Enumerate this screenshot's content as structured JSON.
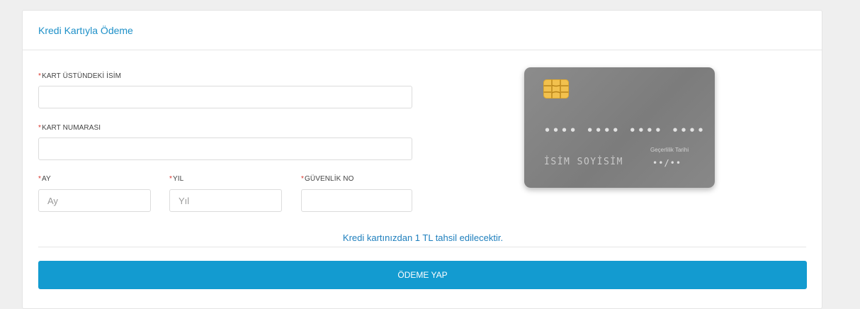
{
  "header": {
    "title": "Kredi Kartıyla Ödeme"
  },
  "form": {
    "required_mark": "*",
    "card_name": {
      "label": "KART ÜSTÜNDEKİ İSİM",
      "value": "",
      "placeholder": ""
    },
    "card_number": {
      "label": "KART NUMARASI",
      "value": "",
      "placeholder": ""
    },
    "month": {
      "label": "AY",
      "value": "",
      "placeholder": "Ay"
    },
    "year": {
      "label": "YIL",
      "value": "",
      "placeholder": "Yıl"
    },
    "cvv": {
      "label": "GÜVENLİK NO",
      "value": "",
      "placeholder": ""
    }
  },
  "card_preview": {
    "number_mask": "•••• •••• •••• ••••",
    "holder": "İSİM SOYİSİM",
    "expiry_label": "Geçerlilik Tarihi",
    "expiry_mask": "••/••",
    "chip_icon": "card-chip-icon"
  },
  "notice": "Kredi kartınızdan 1 TL tahsil edilecektir.",
  "actions": {
    "pay_label": "ÖDEME YAP"
  },
  "colors": {
    "accent": "#1e90c8",
    "button": "#139bd0",
    "required": "#d9342b",
    "card": "#838383"
  }
}
